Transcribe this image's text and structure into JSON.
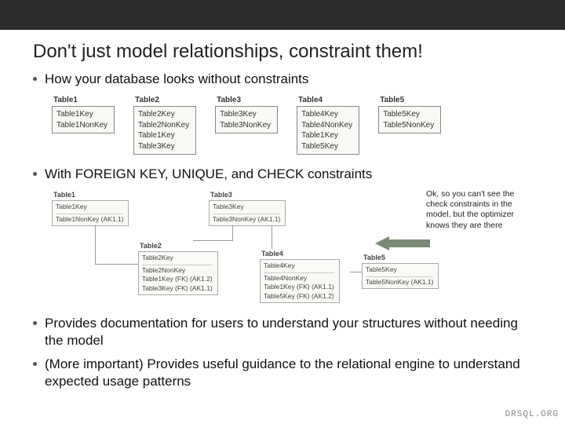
{
  "title": "Don't just model relationships, constraint them!",
  "bullets": {
    "b1": "How your database looks without constraints",
    "b2": "With FOREIGN KEY, UNIQUE, and CHECK constraints",
    "b3": "Provides documentation for users to understand your structures without needing the model",
    "b4": "(More important) Provides useful guidance to the relational engine to understand expected usage patterns"
  },
  "diag1": {
    "t1": {
      "name": "Table1",
      "cols": [
        "Table1Key",
        "Table1NonKey"
      ]
    },
    "t2": {
      "name": "Table2",
      "cols": [
        "Table2Key",
        "Table2NonKey",
        "Table1Key",
        "Table3Key"
      ]
    },
    "t3": {
      "name": "Table3",
      "cols": [
        "Table3Key",
        "Table3NonKey"
      ]
    },
    "t4": {
      "name": "Table4",
      "cols": [
        "Table4Key",
        "Table4NonKey",
        "Table1Key",
        "Table5Key"
      ]
    },
    "t5": {
      "name": "Table5",
      "cols": [
        "Table5Key",
        "Table5NonKey"
      ]
    }
  },
  "diag2": {
    "t1": {
      "name": "Table1",
      "cols": [
        "Table1Key",
        "Table1NonKey (AK1.1)"
      ]
    },
    "t2": {
      "name": "Table2",
      "cols": [
        "Table2Key",
        "Table2NonKey",
        "Table1Key (FK) (AK1.2)",
        "Table3Key (FK) (AK1.1)"
      ]
    },
    "t3": {
      "name": "Table3",
      "cols": [
        "Table3Key",
        "Table3NonKey (AK1.1)"
      ]
    },
    "t4": {
      "name": "Table4",
      "cols": [
        "Table4Key",
        "Table4NonKey",
        "Table1Key (FK) (AK1.1)",
        "Table5Key (FK) (AK1.2)"
      ]
    },
    "t5": {
      "name": "Table5",
      "cols": [
        "Table5Key",
        "Table5NonKey (AK1.1)"
      ]
    }
  },
  "callout": "Ok, so you can't see the check constraints in the model, but the optimizer knows they are there",
  "footer": "DRSQL.ORG"
}
